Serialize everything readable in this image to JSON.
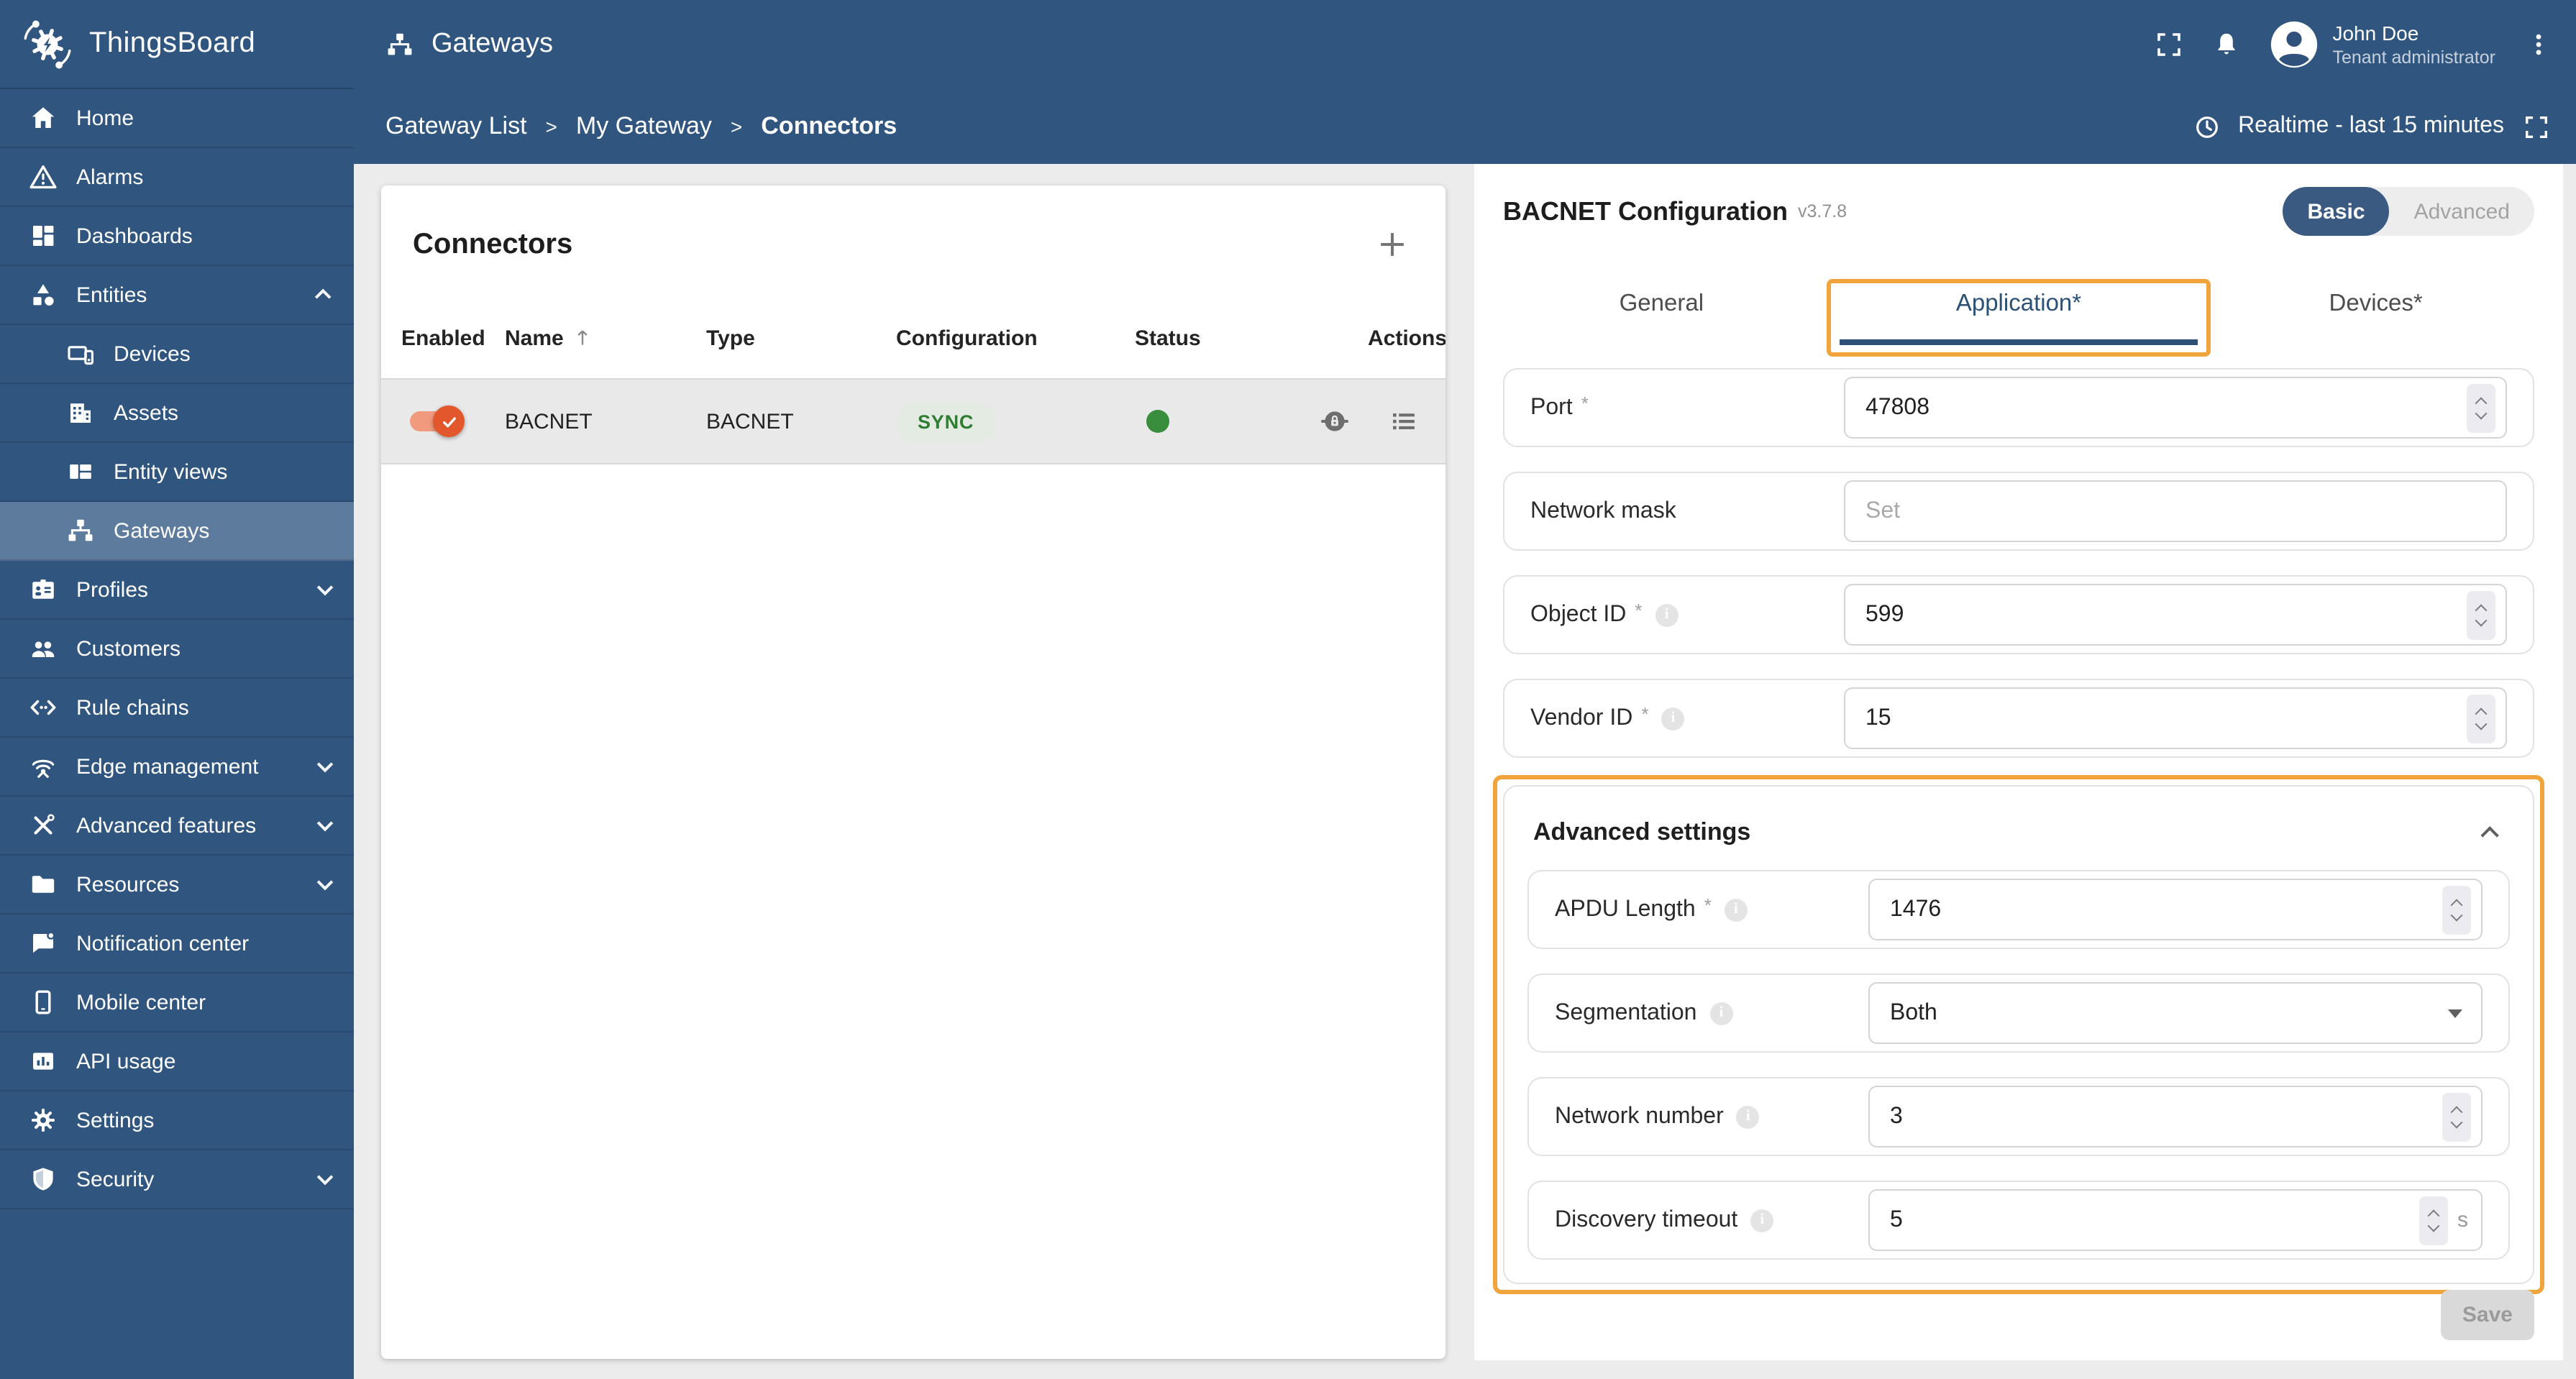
{
  "brand": {
    "name": "ThingsBoard"
  },
  "toolbar": {
    "title": "Gateways"
  },
  "user": {
    "name": "John Doe",
    "role": "Tenant administrator"
  },
  "timewindow": {
    "label": "Realtime - last 15 minutes"
  },
  "breadcrumb": {
    "separator": ">",
    "items": [
      "Gateway List",
      "My Gateway",
      "Connectors"
    ]
  },
  "sidebar": {
    "items": [
      {
        "label": "Home"
      },
      {
        "label": "Alarms"
      },
      {
        "label": "Dashboards"
      },
      {
        "label": "Entities"
      },
      {
        "label": "Devices"
      },
      {
        "label": "Assets"
      },
      {
        "label": "Entity views"
      },
      {
        "label": "Gateways"
      },
      {
        "label": "Profiles"
      },
      {
        "label": "Customers"
      },
      {
        "label": "Rule chains"
      },
      {
        "label": "Edge management"
      },
      {
        "label": "Advanced features"
      },
      {
        "label": "Resources"
      },
      {
        "label": "Notification center"
      },
      {
        "label": "Mobile center"
      },
      {
        "label": "API usage"
      },
      {
        "label": "Settings"
      },
      {
        "label": "Security"
      }
    ]
  },
  "connectors": {
    "title": "Connectors",
    "columns": [
      "Enabled",
      "Name",
      "Type",
      "Configuration",
      "Status",
      "Actions"
    ],
    "row": {
      "name": "BACNET",
      "type": "BACNET",
      "configuration": "SYNC",
      "enabled": true
    }
  },
  "config": {
    "title": "BACNET Configuration",
    "version": "v3.7.8",
    "mode": {
      "basic": "Basic",
      "advanced": "Advanced",
      "selected": "Basic"
    },
    "tabs": {
      "general": "General",
      "application": "Application*",
      "devices": "Devices*",
      "active": "Application*"
    },
    "required_marker": "*",
    "fields": {
      "port": {
        "label": "Port",
        "value": "47808"
      },
      "network_mask": {
        "label": "Network mask",
        "placeholder": "Set"
      },
      "object_id": {
        "label": "Object ID",
        "value": "599"
      },
      "vendor_id": {
        "label": "Vendor ID",
        "value": "15"
      }
    },
    "advanced_settings": {
      "title": "Advanced settings",
      "fields": {
        "apdu_length": {
          "label": "APDU Length",
          "value": "1476"
        },
        "segmentation": {
          "label": "Segmentation",
          "value": "Both"
        },
        "network_number": {
          "label": "Network number",
          "value": "3"
        },
        "discovery_timeout": {
          "label": "Discovery timeout",
          "value": "5",
          "suffix": "s"
        }
      }
    },
    "save_label": "Save"
  },
  "icons": {
    "thingsboard-logo": "gear-with-orbits",
    "gateways": "lan-hub",
    "add": "plus",
    "sort": "arrow-up",
    "rpc": "circle-lock",
    "logs": "list",
    "delete": "trash",
    "fullscreen": "corner-brackets",
    "notifications": "bell",
    "account": "avatar-circle",
    "more": "kebab-dots",
    "timewindow": "clock",
    "info": "i-circle"
  },
  "colors": {
    "primary": "#305680",
    "highlight": "#f1a33c",
    "toggle_on": "#e2572b",
    "sync_chip_bg": "#e3ebe3",
    "sync_chip_text": "#2e7d32",
    "status_ok": "#388e3c"
  }
}
